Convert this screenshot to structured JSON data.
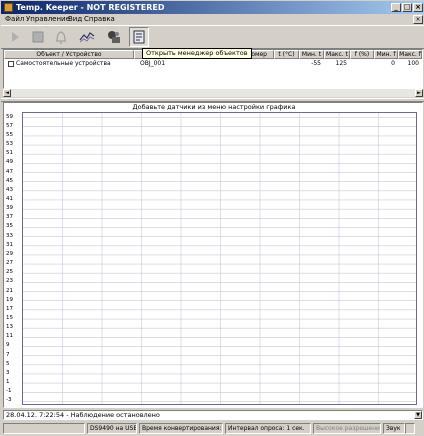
{
  "window": {
    "title": "Temp. Keeper  - NOT REGISTERED",
    "controls": [
      "_",
      "□",
      "×"
    ]
  },
  "menu": [
    "Файл",
    "Управление",
    "Вид",
    "Справка"
  ],
  "toolbar": {
    "buttons": [
      "play-icon",
      "stop-icon",
      "bell-icon",
      "chart-icon",
      "devices-icon",
      "object-manager-icon"
    ],
    "tooltip": "Открыть менеджер объектов"
  },
  "table": {
    "columns": [
      "Объект / Устройство",
      "ный номер",
      "t (°C)",
      "Мин. t",
      "Макс. t",
      "f (%)",
      "Мин. f",
      "Макс. f"
    ],
    "rows": [
      {
        "object": "Самостоятельные устройства",
        "serial": "OBJ_001",
        "t": "",
        "min_t": "-55",
        "max_t": "125",
        "f": "",
        "min_f": "0",
        "max_f": "100"
      }
    ]
  },
  "chart": {
    "title": "Добавьте датчики из меню настройки графика",
    "y_ticks": [
      "59",
      "57",
      "55",
      "53",
      "51",
      "49",
      "47",
      "45",
      "43",
      "41",
      "39",
      "37",
      "35",
      "33",
      "31",
      "29",
      "27",
      "25",
      "23",
      "21",
      "19",
      "17",
      "15",
      "13",
      "11",
      "9",
      "7",
      "5",
      "3",
      "1",
      "-1",
      "-3"
    ],
    "grid_color": "#c8c8e0"
  },
  "log": {
    "text": "28.04.12. 7:22:54 - Наблюдение остановлено"
  },
  "status": {
    "device": "DS9490 на USB",
    "conversion": "Время конвертирования: 750 uS.",
    "interval": "Интервал опроса: 1 сек.",
    "resolution": "Высокое разрешение",
    "sound": "Звук"
  }
}
